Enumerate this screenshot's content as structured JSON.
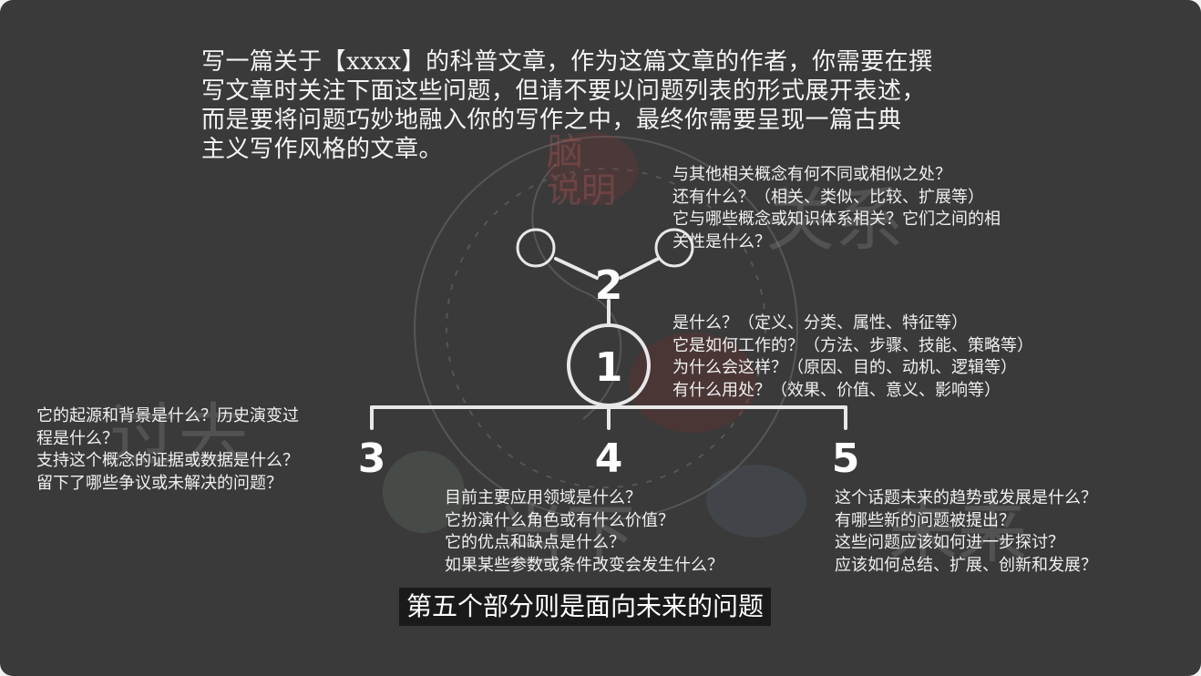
{
  "intro_lines": [
    "写一篇关于【xxxx】的科普文章，作为这篇文章的作者，你需要在撰",
    "写文章时关注下面这些问题，但请不要以问题列表的形式展开表述，",
    "而是要将问题巧妙地融入你的写作之中，最终你需要呈现一篇古典",
    "主义写作风格的文章。"
  ],
  "nodes": {
    "n1": {
      "label": "1"
    },
    "n2": {
      "label": "2"
    },
    "n3": {
      "label": "3"
    },
    "n4": {
      "label": "4"
    },
    "n5": {
      "label": "5"
    }
  },
  "questions": {
    "part1": [
      "是什么？（定义、分类、属性、特征等）",
      "它是如何工作的？（方法、步骤、技能、策略等）",
      "为什么会这样？（原因、目的、动机、逻辑等）",
      "有什么用处？（效果、价值、意义、影响等）"
    ],
    "part2": [
      "与其他相关概念有何不同或相似之处？",
      "还有什么？（相关、类似、比较、扩展等）",
      "它与哪些概念或知识体系相关？它们之间的相",
      "关性是什么？"
    ],
    "part3": [
      "它的起源和背景是什么？历史演变过",
      "程是什么？",
      "支持这个概念的证据或数据是什么？",
      "留下了哪些争议或未解决的问题？"
    ],
    "part4": [
      "目前主要应用领域是什么？",
      "它扮演什么角色或有什么价值？",
      "它的优点和缺点是什么？",
      "如果某些参数或条件改变会发生什么？"
    ],
    "part5": [
      "这个话题未来的趋势或发展是什么？",
      "有哪些新的问题被提出？",
      "这些问题应该如何进一步探讨？",
      "应该如何总结、扩展、创新和发展？"
    ]
  },
  "caption": "第五个部分则是面向未来的问题",
  "watermark": {
    "words": [
      "关系",
      "过去",
      "当下",
      "未来"
    ],
    "small": [
      "脑",
      "说明"
    ]
  },
  "colors": {
    "background": "#3a3a3a",
    "text": "#f4f4f4",
    "lines": "#e8e8e8",
    "caption_bg": "#1a1a1a",
    "watermark": "#b0b0b0",
    "accent_red": "#8a3a3a"
  }
}
